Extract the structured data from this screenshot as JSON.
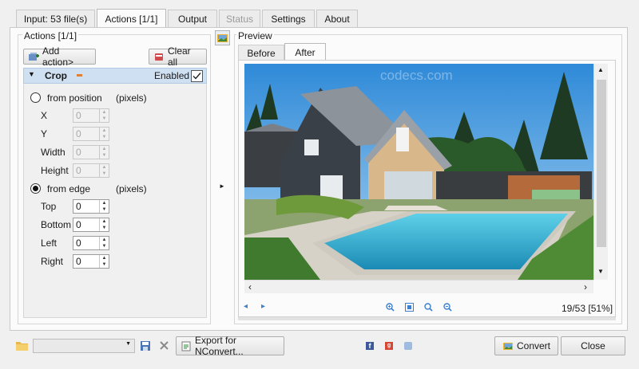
{
  "tabs": [
    {
      "label": "Input: 53 file(s)"
    },
    {
      "label": "Actions [1/1]"
    },
    {
      "label": "Output"
    },
    {
      "label": "Status"
    },
    {
      "label": "Settings"
    },
    {
      "label": "About"
    }
  ],
  "actions_panel": {
    "title": "Actions [1/1]",
    "add_action_label": "Add action>",
    "clear_all_label": "Clear all",
    "crop": {
      "title": "Crop",
      "enabled_label": "Enabled",
      "enabled": true,
      "from_position_label": "from position",
      "from_position_unit": "(pixels)",
      "position_fields": [
        {
          "label": "X",
          "value": "0"
        },
        {
          "label": "Y",
          "value": "0"
        },
        {
          "label": "Width",
          "value": "0"
        },
        {
          "label": "Height",
          "value": "0"
        }
      ],
      "from_edge_label": "from edge",
      "from_edge_unit": "(pixels)",
      "edge_fields": [
        {
          "label": "Top",
          "value": "0"
        },
        {
          "label": "Bottom",
          "value": "0"
        },
        {
          "label": "Left",
          "value": "0"
        },
        {
          "label": "Right",
          "value": "0"
        }
      ],
      "selected_mode": "from edge"
    }
  },
  "preview": {
    "title": "Preview",
    "tabs": [
      {
        "label": "Before"
      },
      {
        "label": "After"
      }
    ],
    "active_tab": "After",
    "watermark": "codecs.com",
    "page_info": "19/53 [51%]"
  },
  "bottom_bar": {
    "export_label": "Export for NConvert...",
    "convert_label": "Convert",
    "close_label": "Close"
  },
  "colors": {
    "selection_blue": "#cfe0f2",
    "window_bg": "#f0f0f0"
  }
}
